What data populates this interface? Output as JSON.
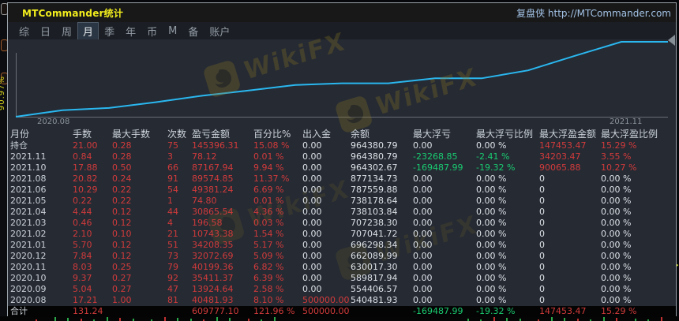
{
  "background": {
    "vertical_label": "90.97%"
  },
  "watermark": {
    "text": "WikiFX"
  },
  "colors": {
    "accent_red": "#d23b3b",
    "accent_green": "#1acb70",
    "line_cyan": "#2ab7ef",
    "title_yellow": "#f2ee1d"
  },
  "window": {
    "title": "MTCommander统计",
    "brand": "复盘侠 http://MTCommander.com",
    "menu": {
      "items": [
        "综",
        "日",
        "周",
        "月",
        "季",
        "年",
        "币",
        "M",
        "备",
        "账户"
      ],
      "active_index": 3
    }
  },
  "chart_data": {
    "type": "line",
    "title": "",
    "xlabel": "",
    "ylabel": "",
    "x_tick_labels": [
      "2020.08",
      "2021.11"
    ],
    "series": [
      {
        "name": "余额",
        "values": [
          500000,
          540481.93,
          554406.57,
          589817.94,
          630017.3,
          662089.99,
          696298.34,
          707041.72,
          707238.3,
          738103.84,
          738178.64,
          787559.88,
          877134.73,
          964302.67,
          964380.79
        ]
      }
    ],
    "ylim": [
      500000,
      980000
    ],
    "grid": false,
    "legend": "none",
    "line_color": "#2ab7ef"
  },
  "table": {
    "columns": [
      "月份",
      "手数",
      "最大手数",
      "次数",
      "盈亏金额",
      "百分比%",
      "出入金",
      "余额",
      "最大浮亏",
      "最大浮亏比例",
      "最大浮盈金额",
      "最大浮盈比例"
    ],
    "rows": [
      {
        "cells": [
          "持仓",
          "21.00",
          "0.28",
          "75",
          "145396.31",
          "15.08 %",
          "0.00",
          "964380.79",
          "0.00",
          "0.00 %",
          "147453.47",
          "15.29 %"
        ],
        "colors": [
          "w",
          "r",
          "r",
          "r",
          "r",
          "r",
          "w",
          "w",
          "w",
          "w",
          "r",
          "r"
        ],
        "footer": false
      },
      {
        "cells": [
          "2021.11",
          "0.84",
          "0.28",
          "3",
          "78.12",
          "0.01 %",
          "0.00",
          "964380.79",
          "-23268.85",
          "-2.41 %",
          "34203.47",
          "3.55 %"
        ],
        "colors": [
          "w",
          "r",
          "r",
          "r",
          "r",
          "r",
          "w",
          "w",
          "g",
          "g",
          "r",
          "r"
        ],
        "footer": false
      },
      {
        "cells": [
          "2021.10",
          "17.88",
          "0.50",
          "66",
          "87167.94",
          "9.94 %",
          "0.00",
          "964302.67",
          "-169487.99",
          "-19.32 %",
          "90065.88",
          "10.27 %"
        ],
        "colors": [
          "w",
          "r",
          "r",
          "r",
          "r",
          "r",
          "w",
          "w",
          "g",
          "g",
          "r",
          "r"
        ],
        "footer": false
      },
      {
        "cells": [
          "2021.08",
          "20.82",
          "0.24",
          "91",
          "89574.85",
          "11.37 %",
          "0.00",
          "877134.73",
          "0.00",
          "0.00 %",
          "0",
          "0.00 %"
        ],
        "colors": [
          "w",
          "r",
          "r",
          "r",
          "r",
          "r",
          "w",
          "w",
          "w",
          "w",
          "w",
          "w"
        ],
        "footer": false
      },
      {
        "cells": [
          "2021.06",
          "10.29",
          "0.22",
          "54",
          "49381.24",
          "6.69 %",
          "0.00",
          "787559.88",
          "0.00",
          "0.00 %",
          "0",
          "0.00 %"
        ],
        "colors": [
          "w",
          "r",
          "r",
          "r",
          "r",
          "r",
          "w",
          "w",
          "w",
          "w",
          "w",
          "w"
        ],
        "footer": false
      },
      {
        "cells": [
          "2021.05",
          "0.22",
          "0.22",
          "1",
          "74.80",
          "0.01 %",
          "0.00",
          "738178.64",
          "0.00",
          "0.00 %",
          "0",
          "0.00 %"
        ],
        "colors": [
          "w",
          "r",
          "r",
          "r",
          "r",
          "r",
          "w",
          "w",
          "w",
          "w",
          "w",
          "w"
        ],
        "footer": false
      },
      {
        "cells": [
          "2021.04",
          "4.44",
          "0.12",
          "44",
          "30865.54",
          "4.36 %",
          "0.00",
          "738103.84",
          "0.00",
          "0.00 %",
          "0",
          "0.00 %"
        ],
        "colors": [
          "w",
          "r",
          "r",
          "r",
          "r",
          "r",
          "w",
          "w",
          "w",
          "w",
          "w",
          "w"
        ],
        "footer": false
      },
      {
        "cells": [
          "2021.03",
          "0.46",
          "0.12",
          "4",
          "196.58",
          "0.03 %",
          "0.00",
          "707238.30",
          "0.00",
          "0.00 %",
          "0",
          "0.00 %"
        ],
        "colors": [
          "w",
          "r",
          "r",
          "r",
          "r",
          "r",
          "w",
          "w",
          "w",
          "w",
          "w",
          "w"
        ],
        "footer": false
      },
      {
        "cells": [
          "2021.02",
          "2.10",
          "0.10",
          "21",
          "10743.38",
          "1.54 %",
          "0.00",
          "707041.72",
          "0.00",
          "0.00 %",
          "0",
          "0.00 %"
        ],
        "colors": [
          "w",
          "r",
          "r",
          "r",
          "r",
          "r",
          "w",
          "w",
          "w",
          "w",
          "w",
          "w"
        ],
        "footer": false
      },
      {
        "cells": [
          "2021.01",
          "5.70",
          "0.12",
          "51",
          "34208.35",
          "5.17 %",
          "0.00",
          "696298.34",
          "0.00",
          "0.00 %",
          "0",
          "0.00 %"
        ],
        "colors": [
          "w",
          "r",
          "r",
          "r",
          "r",
          "r",
          "w",
          "w",
          "w",
          "w",
          "w",
          "w"
        ],
        "footer": false
      },
      {
        "cells": [
          "2020.12",
          "7.84",
          "0.12",
          "73",
          "32072.69",
          "5.09 %",
          "0.00",
          "662089.99",
          "0.00",
          "0.00 %",
          "0",
          "0.00 %"
        ],
        "colors": [
          "w",
          "r",
          "r",
          "r",
          "r",
          "r",
          "w",
          "w",
          "w",
          "w",
          "w",
          "w"
        ],
        "footer": false
      },
      {
        "cells": [
          "2020.11",
          "8.03",
          "0.25",
          "79",
          "40199.36",
          "6.82 %",
          "0.00",
          "630017.30",
          "0.00",
          "0.00 %",
          "0",
          "0.00 %"
        ],
        "colors": [
          "w",
          "r",
          "r",
          "r",
          "r",
          "r",
          "w",
          "w",
          "w",
          "w",
          "w",
          "w"
        ],
        "footer": false
      },
      {
        "cells": [
          "2020.10",
          "9.37",
          "0.27",
          "92",
          "35411.37",
          "6.39 %",
          "0.00",
          "589817.94",
          "0.00",
          "0.00 %",
          "0",
          "0.00 %"
        ],
        "colors": [
          "w",
          "r",
          "r",
          "r",
          "r",
          "r",
          "w",
          "w",
          "w",
          "w",
          "w",
          "w"
        ],
        "footer": false
      },
      {
        "cells": [
          "2020.09",
          "5.04",
          "0.27",
          "47",
          "13924.64",
          "2.58 %",
          "0.00",
          "554406.57",
          "0.00",
          "0.00 %",
          "0",
          "0.00 %"
        ],
        "colors": [
          "w",
          "r",
          "r",
          "r",
          "r",
          "r",
          "w",
          "w",
          "w",
          "w",
          "w",
          "w"
        ],
        "footer": false
      },
      {
        "cells": [
          "2020.08",
          "17.21",
          "1.00",
          "81",
          "40481.93",
          "8.10 %",
          "500000.00",
          "540481.93",
          "0.00",
          "0.00 %",
          "0",
          "0.00 %"
        ],
        "colors": [
          "w",
          "r",
          "r",
          "r",
          "r",
          "r",
          "r",
          "w",
          "w",
          "w",
          "w",
          "w"
        ],
        "footer": false
      },
      {
        "cells": [
          "合计",
          "131.24",
          "",
          "",
          "609777.10",
          "121.96 %",
          "500000.00",
          "",
          "-169487.99",
          "-19.32 %",
          "147453.47",
          "15.29 %"
        ],
        "colors": [
          "w",
          "r",
          "w",
          "w",
          "r",
          "r",
          "r",
          "w",
          "g",
          "g",
          "r",
          "r"
        ],
        "footer": true
      }
    ]
  }
}
